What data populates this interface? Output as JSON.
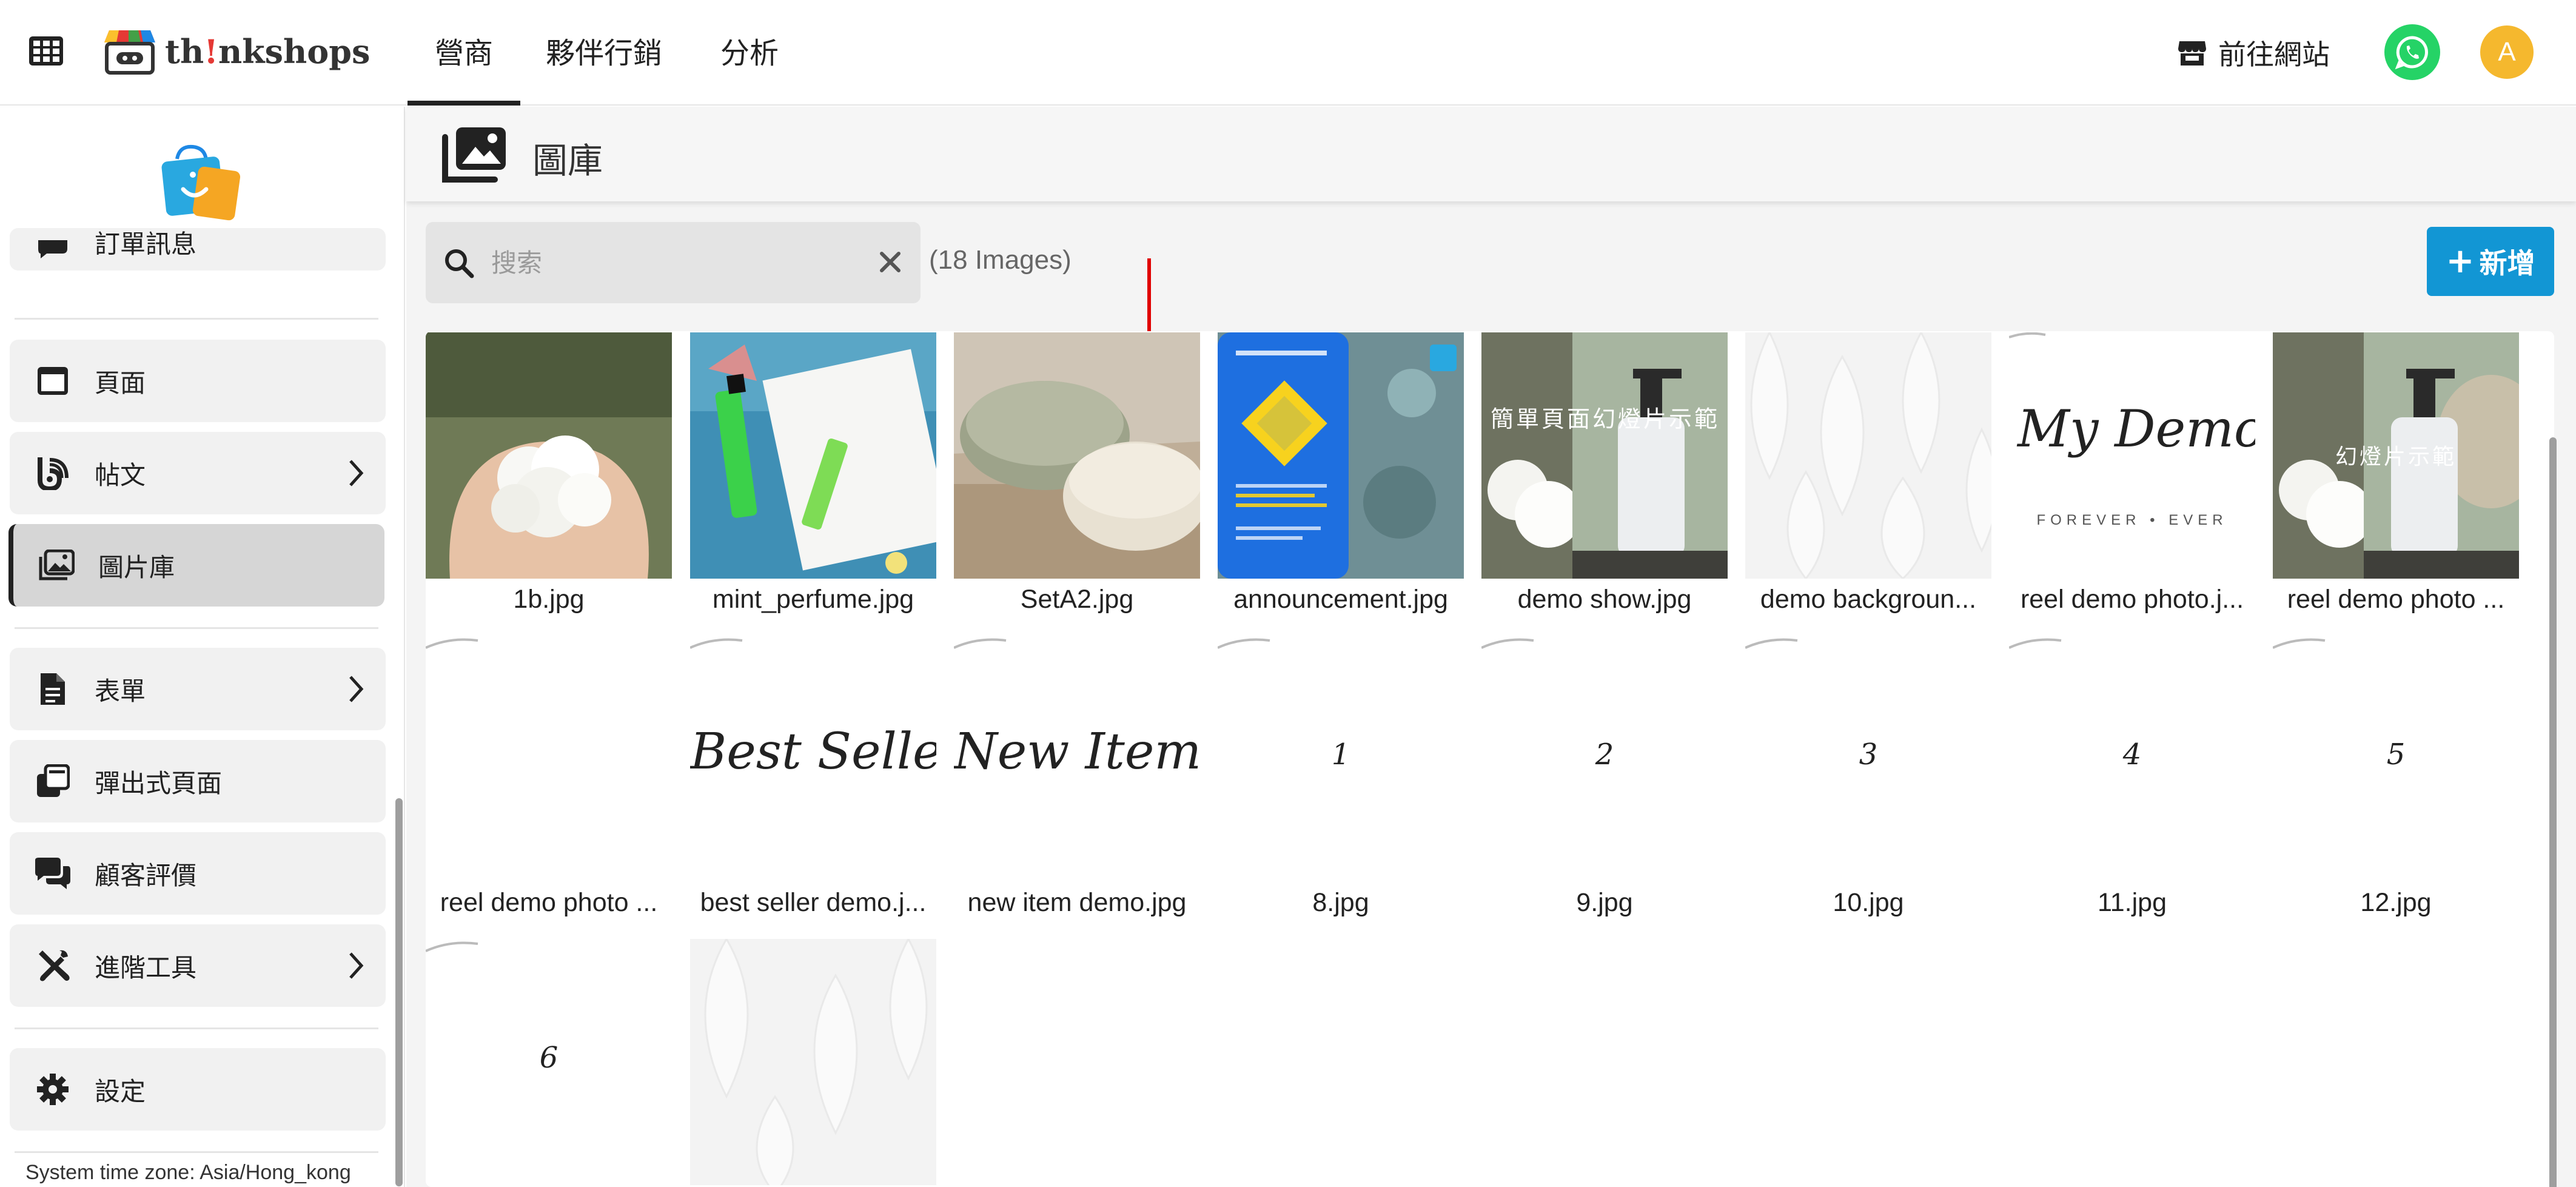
{
  "topbar": {
    "brand": {
      "text_pre": "th",
      "text_bang": "!",
      "text_post": "nkshops"
    },
    "nav_tabs": [
      {
        "label": "營商"
      },
      {
        "label": "夥伴行銷"
      },
      {
        "label": "分析"
      }
    ],
    "visit_site_label": "前往網站",
    "avatar_letter": "A"
  },
  "sidebar": {
    "cut_item_label": "訂單訊息",
    "items": [
      {
        "label": "頁面",
        "icon": "page-icon"
      },
      {
        "label": "帖文",
        "icon": "blog-icon",
        "has_submenu": true
      },
      {
        "label": "圖片庫",
        "icon": "gallery-icon",
        "active": true
      },
      {
        "label": "表單",
        "icon": "form-icon",
        "has_submenu": true
      },
      {
        "label": "彈出式頁面",
        "icon": "popup-icon"
      },
      {
        "label": "顧客評價",
        "icon": "reviews-icon"
      },
      {
        "label": "進階工具",
        "icon": "tools-icon",
        "has_submenu": true
      },
      {
        "label": "設定",
        "icon": "gear-icon"
      }
    ],
    "timezone": "System time zone: Asia/Hong_kong"
  },
  "page": {
    "title": "圖庫",
    "search": {
      "placeholder": "搜索",
      "value": ""
    },
    "image_count": "(18 Images)",
    "add_button": "新增"
  },
  "gallery": {
    "images": [
      {
        "caption": "1b.jpg"
      },
      {
        "caption": "mint_perfume.jpg"
      },
      {
        "caption": "SetA2.jpg"
      },
      {
        "caption": "announcement.jpg"
      },
      {
        "caption": "demo show.jpg",
        "overlay": "簡單頁面幻燈片示範"
      },
      {
        "caption": "demo backgroun..."
      },
      {
        "caption": "reel demo photo.j...",
        "script_text": "My Demo Sho",
        "subtitle": "FOREVER • EVER"
      },
      {
        "caption": "reel demo photo ...",
        "overlay": "幻燈片示範"
      },
      {
        "caption": "reel demo photo ..."
      },
      {
        "caption": "best seller demo.j...",
        "script_text": "Best Seller"
      },
      {
        "caption": "new item demo.jpg",
        "script_text": "New Items"
      },
      {
        "caption": "8.jpg",
        "script_text": "1"
      },
      {
        "caption": "9.jpg",
        "script_text": "2"
      },
      {
        "caption": "10.jpg",
        "script_text": "3"
      },
      {
        "caption": "11.jpg",
        "script_text": "4"
      },
      {
        "caption": "12.jpg",
        "script_text": "5"
      },
      {
        "caption": "",
        "script_text": "6"
      },
      {
        "caption": ""
      }
    ]
  },
  "colors": {
    "accent_blue": "#1296d4",
    "whatsapp_green": "#25d366",
    "avatar_yellow": "#f5b82e",
    "arrow_red": "#e00000"
  }
}
